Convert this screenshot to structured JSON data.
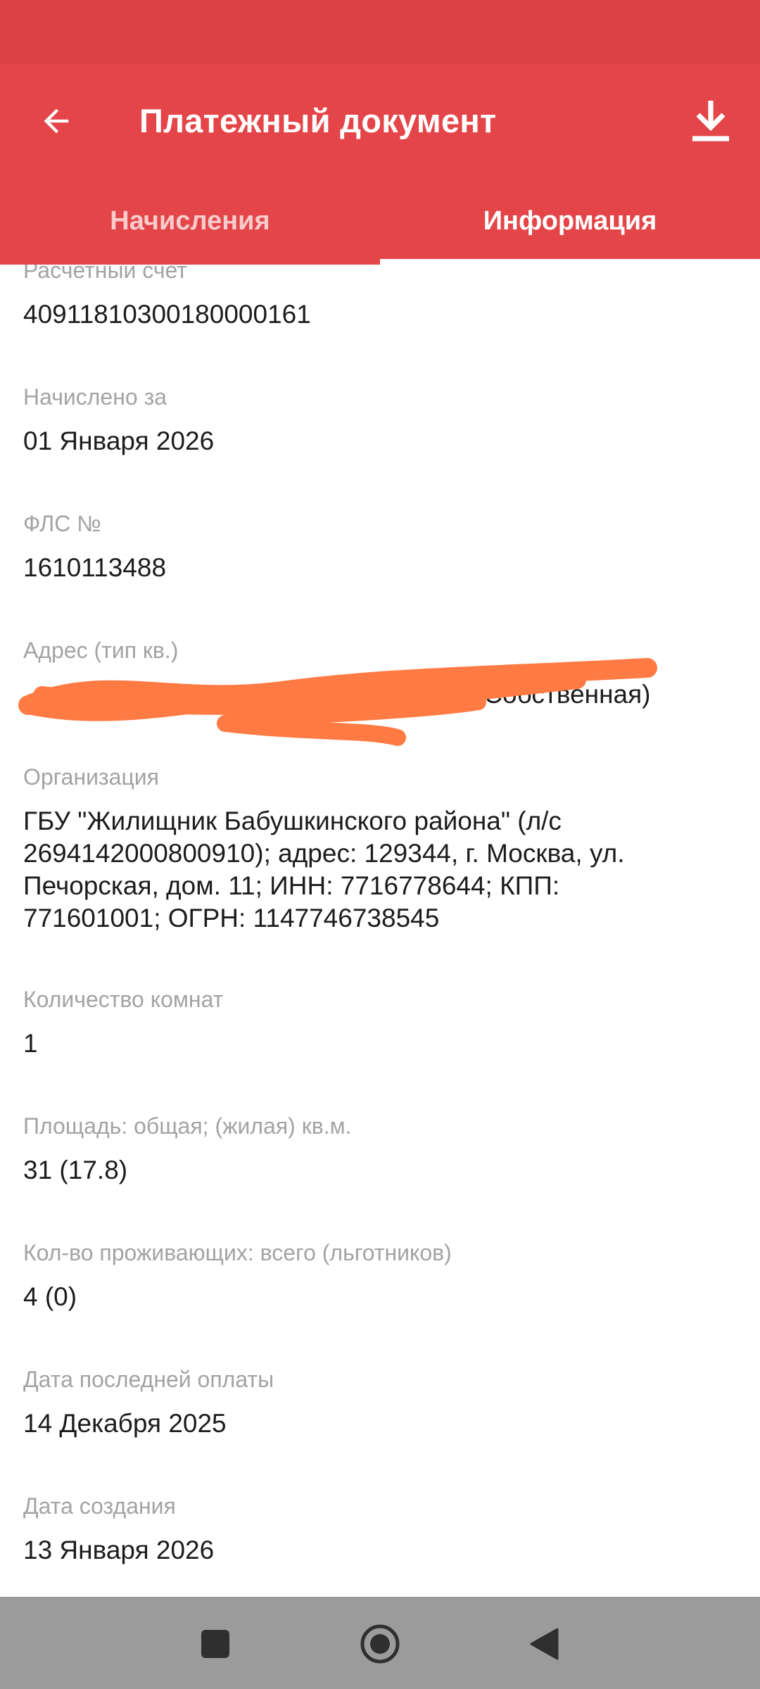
{
  "header": {
    "title": "Платежный документ",
    "back_icon": "arrow-left-icon",
    "download_icon": "download-icon",
    "background_color": "#e44548",
    "status_bar_color": "#dc4245"
  },
  "tabs": [
    {
      "label": "Начисления",
      "active": false
    },
    {
      "label": "Информация",
      "active": true
    }
  ],
  "fields": {
    "account": {
      "label": "Расчетный счет",
      "value": "40911810300180000161"
    },
    "period": {
      "label": "Начислено за",
      "value": "01 Января 2026"
    },
    "fls": {
      "label": "ФЛС №",
      "value": "1610113488"
    },
    "address": {
      "label": "Адрес (тип кв.)",
      "value": "(Собственная)"
    },
    "organization": {
      "label": "Организация",
      "value": "ГБУ \"Жилищник Бабушкинского района\" (л/с 2694142000800910); адрес: 129344, г. Москва, ул. Печорская, дом. 11; ИНН: 7716778644; КПП: 771601001; ОГРН: 1147746738545"
    },
    "rooms": {
      "label": "Количество комнат",
      "value": "1"
    },
    "area": {
      "label": "Площадь: общая; (жилая) кв.м.",
      "value": "31 (17.8)"
    },
    "residents": {
      "label": "Кол-во проживающих: всего (льготников)",
      "value": "4 (0)"
    },
    "last_payment": {
      "label": "Дата последней оплаты",
      "value": "14 Декабря 2025"
    },
    "created": {
      "label": "Дата создания",
      "value": "13 Января 2026"
    }
  },
  "nav": {
    "recents_icon": "square-icon",
    "home_icon": "home-circle-icon",
    "back_icon": "triangle-back-icon",
    "background_color": "#9b9b9b"
  },
  "redaction_color": "#ff7b43"
}
